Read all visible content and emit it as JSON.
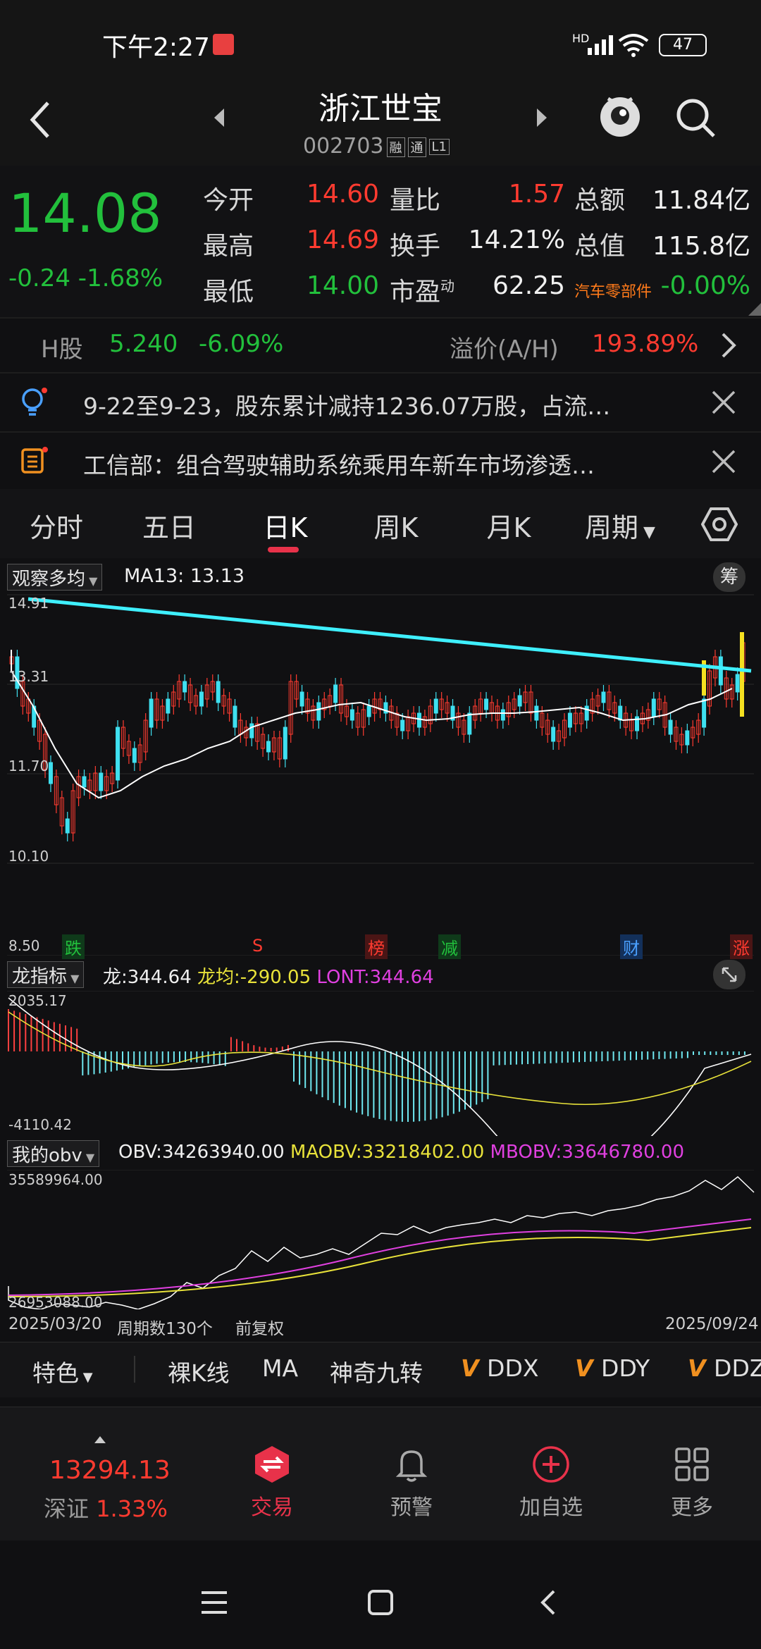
{
  "status_bar": {
    "time": "下午2:27",
    "net": "HD",
    "battery": "47"
  },
  "header": {
    "title": "浙江世宝",
    "code": "002703",
    "tags": [
      "融",
      "通",
      "L1"
    ]
  },
  "quote": {
    "price": "14.08",
    "change": "-0.24",
    "change_pct": "-1.68%",
    "fields": [
      {
        "label": "今开",
        "value": "14.60"
      },
      {
        "label": "最高",
        "value": "14.69"
      },
      {
        "label": "最低",
        "value": "14.00"
      },
      {
        "label": "量比",
        "value": "1.57"
      },
      {
        "label": "换手",
        "value": "14.21%"
      },
      {
        "label": "市盈",
        "sup": "动",
        "value": "62.25"
      },
      {
        "label": "总额",
        "value": "11.84亿"
      },
      {
        "label": "总值",
        "value": "115.8亿"
      },
      {
        "label": "汽车零部件",
        "value": "-0.00%"
      }
    ]
  },
  "h_share": {
    "label": "H股",
    "price": "5.240",
    "change": "-6.09%",
    "premium_label": "溢价(A/H)",
    "premium": "193.89%"
  },
  "news": [
    {
      "text": "9-22至9-23，股东累计减持1236.07万股，占流…"
    },
    {
      "text": "工信部：组合驾驶辅助系统乘用车新车市场渗透…"
    }
  ],
  "tabs": [
    "分时",
    "五日",
    "日K",
    "周K",
    "月K",
    "周期"
  ],
  "active_tab": "日K",
  "main_chart": {
    "indicator": "观察多均",
    "ma_label": "MA13:",
    "ma_value": "13.13",
    "chip_button": "筹",
    "y_ticks": [
      "14.91",
      "13.31",
      "11.70",
      "10.10",
      "8.50"
    ],
    "markers": [
      {
        "text": "跌",
        "color": "#22c03c"
      },
      {
        "text": "S",
        "color": "#ff3b30"
      },
      {
        "text": "榜",
        "color": "#ff3b30"
      },
      {
        "text": "减",
        "color": "#22c03c"
      },
      {
        "text": "财",
        "color": "#2f8cff"
      },
      {
        "text": "涨",
        "color": "#ff3b30"
      }
    ]
  },
  "long_indicator": {
    "name": "龙指标",
    "long_label": "龙:",
    "long_value": "344.64",
    "avg_label": "龙均:",
    "avg_value": "-290.05",
    "lont_label": "LONT:",
    "lont_value": "344.64",
    "y_max": "2035.17",
    "y_min": "-4110.42"
  },
  "obv": {
    "name": "我的obv",
    "obv_label": "OBV:",
    "obv_value": "34263940.00",
    "maobv_label": "MAOBV:",
    "maobv_value": "33218402.00",
    "mbobv_label": "MBOBV:",
    "mbobv_value": "33646780.00",
    "y_max": "35589964.00",
    "y_min": "26953088.00"
  },
  "footer_axis": {
    "start": "2025/03/20",
    "period": "周期数130个",
    "adj": "前复权",
    "end": "2025/09/24"
  },
  "features": {
    "special": "特色",
    "items": [
      "裸K线",
      "MA",
      "神奇九转",
      "DDX",
      "DDY",
      "DDZ"
    ]
  },
  "bottom_nav": {
    "index_value": "13294.13",
    "index_name": "深证",
    "index_change": "1.33%",
    "items": [
      {
        "label": "交易",
        "active": true
      },
      {
        "label": "预警"
      },
      {
        "label": "加自选"
      },
      {
        "label": "更多"
      }
    ]
  },
  "colors": {
    "up": "#ff3b30",
    "down": "#22c03c",
    "accent": "#e8324a",
    "trend": "#3ff0ff"
  }
}
